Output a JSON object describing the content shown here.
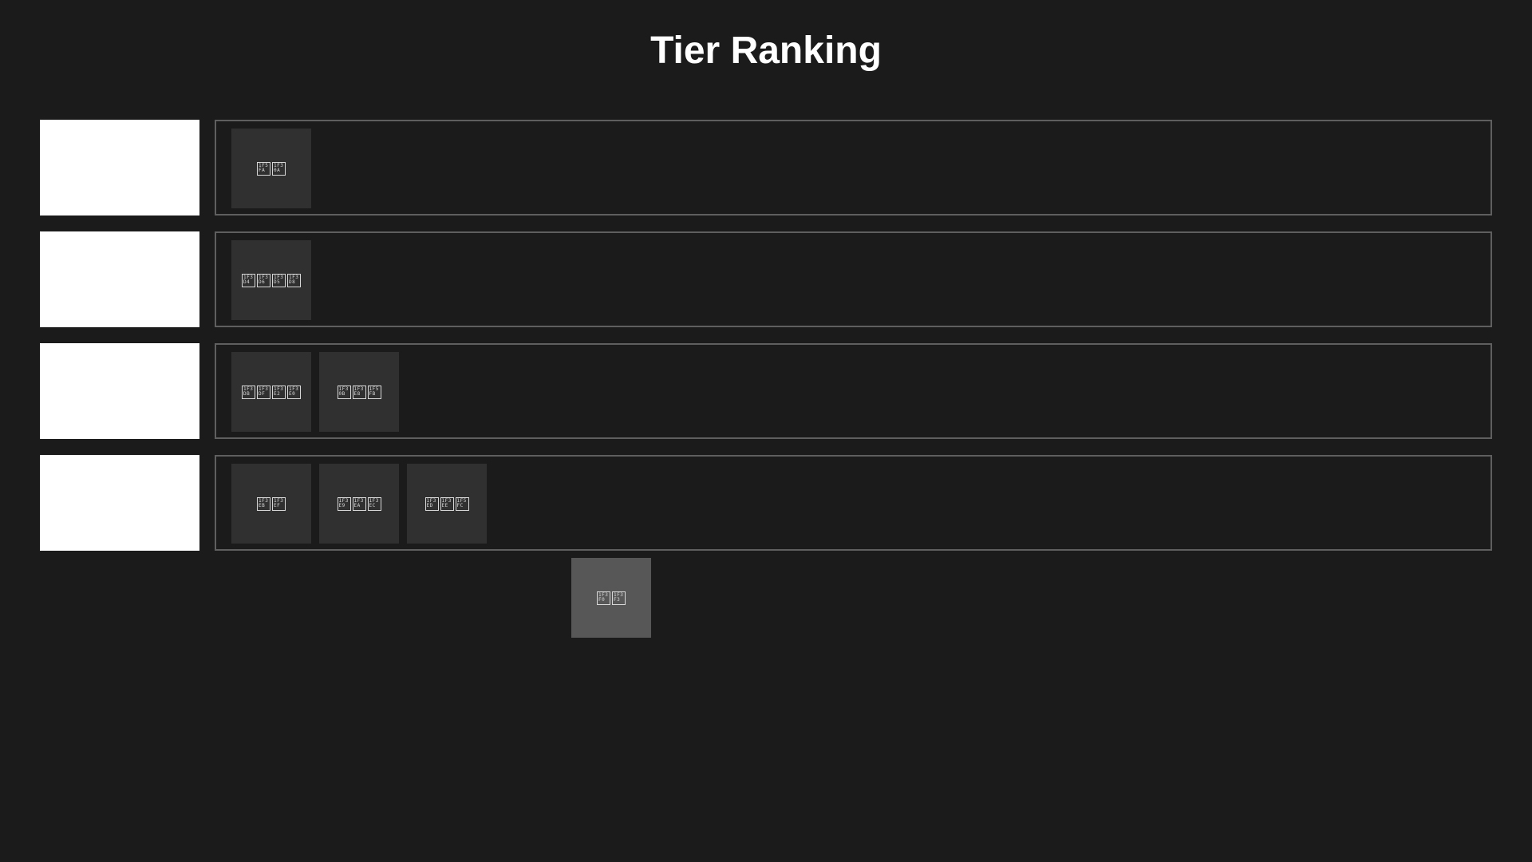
{
  "title": "Tier Ranking",
  "tiers": [
    {
      "label": "",
      "items": [
        {
          "glyphs": [
            "1F5FA",
            "1F30A"
          ]
        }
      ]
    },
    {
      "label": "",
      "items": [
        {
          "glyphs": [
            "1F3D4",
            "1F3D6",
            "1F3D5",
            "1F3D8"
          ]
        }
      ]
    },
    {
      "label": "",
      "items": [
        {
          "glyphs": [
            "1F3DB",
            "1F3DF",
            "1F3E2",
            "1F3E0"
          ]
        },
        {
          "glyphs": [
            "1F30B",
            "1F3E8",
            "1F5FB"
          ]
        }
      ]
    },
    {
      "label": "",
      "items": [
        {
          "glyphs": [
            "1F3EB",
            "1F3EF"
          ]
        },
        {
          "glyphs": [
            "1F3E9",
            "1F3EA",
            "1F3EC"
          ]
        },
        {
          "glyphs": [
            "1F3ED",
            "1F3EE",
            "1F5FC"
          ]
        }
      ]
    }
  ],
  "dragging_item": {
    "glyphs": [
      "1F3F0",
      "1F3F3"
    ]
  },
  "colors": {
    "background": "#1b1b1b",
    "tier_label_bg": "#ffffff",
    "dropzone_border": "#5f5f5f",
    "tile_bg": "#303030",
    "dragging_tile_bg": "#575757"
  }
}
